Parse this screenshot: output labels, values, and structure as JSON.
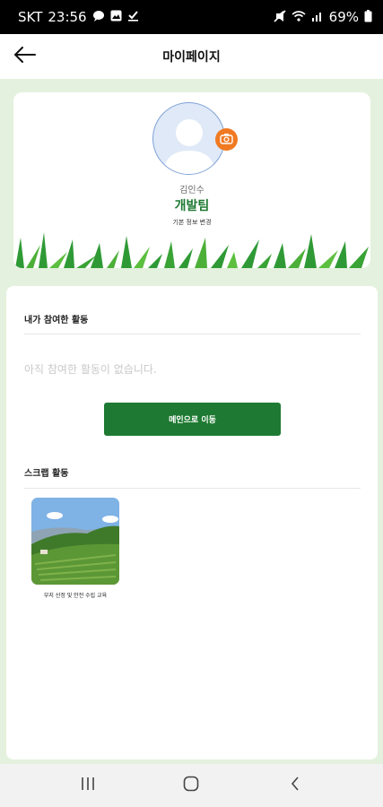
{
  "status_bar": {
    "carrier": "SKT",
    "time": "23:56",
    "battery": "69%",
    "icons": [
      "chat-bubble-icon",
      "gallery-icon",
      "download-icon",
      "mute-icon",
      "wifi-icon",
      "signal-icon",
      "battery-icon"
    ]
  },
  "app_bar": {
    "title": "마이페이지",
    "back_icon": "arrow-left-icon"
  },
  "profile": {
    "name": "김인수",
    "team": "개발팀",
    "edit_label": "기본 정보 변경",
    "camera_icon": "camera-icon",
    "accent_color": "#1e7a32",
    "camera_color": "#f07a22"
  },
  "activities": {
    "title": "내가 참여한 활동",
    "empty_text": "아직 참여한 활동이 없습니다.",
    "button_label": "메인으로 이동"
  },
  "scrap": {
    "title": "스크랩 활동",
    "items": [
      {
        "caption": "부지 선정 및 안전 수립 교육"
      }
    ]
  },
  "nav_bar": {
    "buttons": [
      "recent-apps-icon",
      "home-icon",
      "back-icon"
    ]
  }
}
